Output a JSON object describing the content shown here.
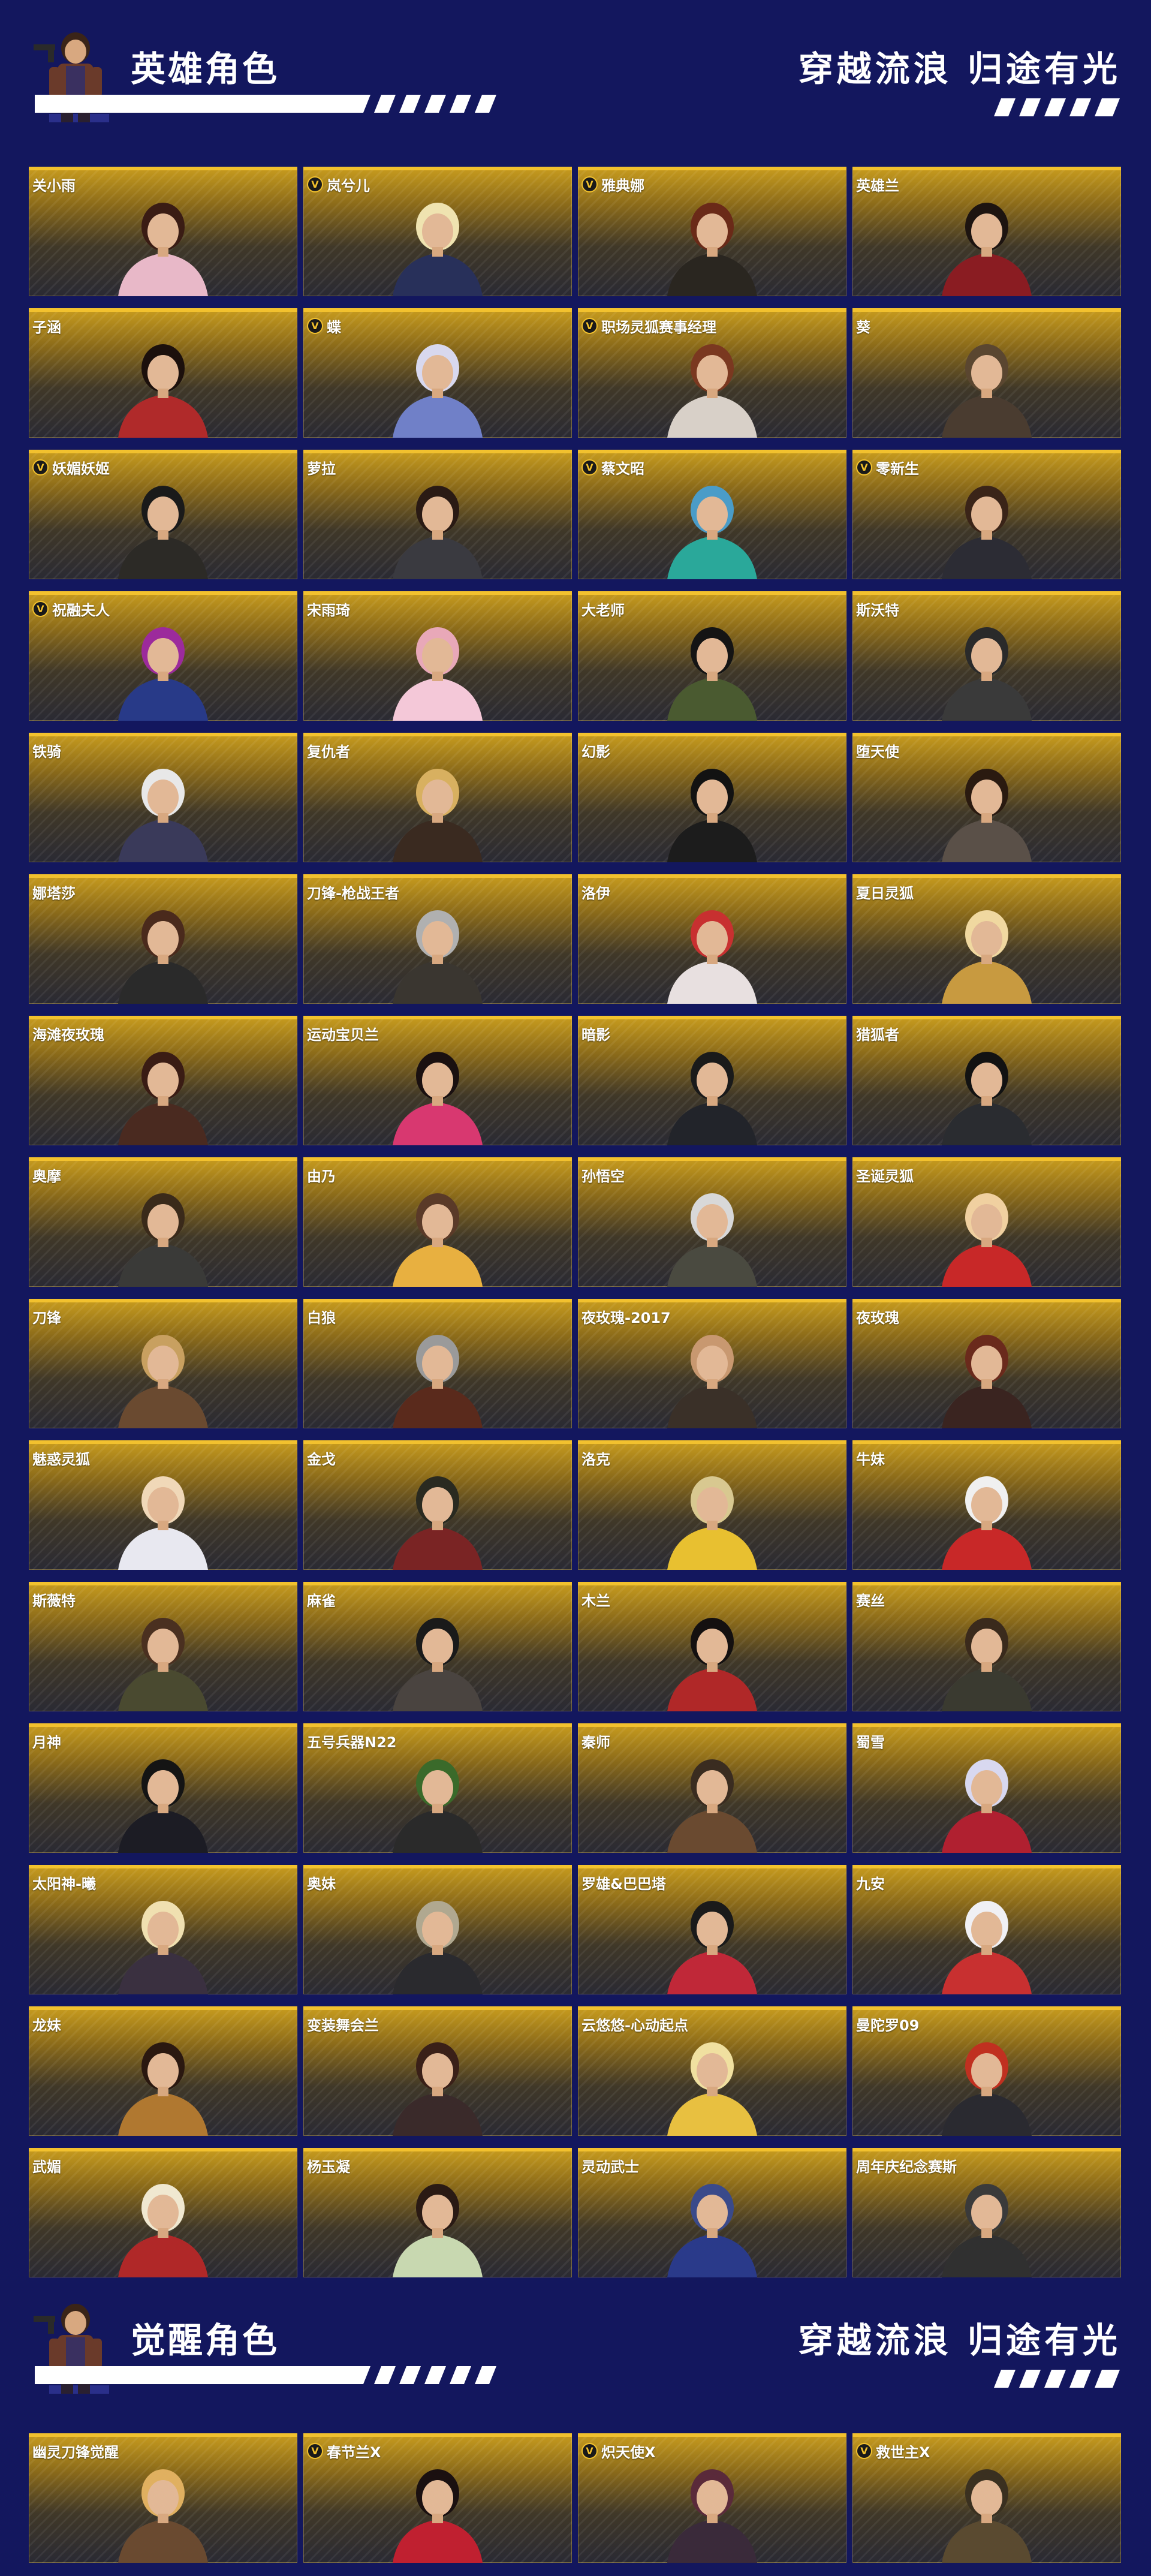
{
  "sections": [
    {
      "title": "英雄角色",
      "slogan": "穿越流浪 归途有光",
      "cards": [
        {
          "name": "关小雨",
          "vip": false,
          "hair": "#3a1c14",
          "outfit": "#e8b8c8"
        },
        {
          "name": "岚兮儿",
          "vip": true,
          "hair": "#efe3b0",
          "outfit": "#28305a"
        },
        {
          "name": "雅典娜",
          "vip": true,
          "hair": "#6a2a18",
          "outfit": "#2a2620"
        },
        {
          "name": "英雄兰",
          "vip": false,
          "hair": "#1d1410",
          "outfit": "#8a1c22"
        },
        {
          "name": "子涵",
          "vip": false,
          "hair": "#1c100c",
          "outfit": "#b02a2a"
        },
        {
          "name": "蝶",
          "vip": true,
          "hair": "#d8d8ee",
          "outfit": "#7080c8"
        },
        {
          "name": "职场灵狐赛事经理",
          "vip": true,
          "hair": "#7a3820",
          "outfit": "#d8d0c8"
        },
        {
          "name": "葵",
          "vip": false,
          "hair": "#5a4630",
          "outfit": "#4a3c30"
        },
        {
          "name": "妖媚妖姬",
          "vip": true,
          "hair": "#1a1a1a",
          "outfit": "#2c2a26"
        },
        {
          "name": "萝拉",
          "vip": false,
          "hair": "#2a1a14",
          "outfit": "#3a3a40"
        },
        {
          "name": "蔡文昭",
          "vip": true,
          "hair": "#4a9cc8",
          "outfit": "#2aa89a"
        },
        {
          "name": "零新生",
          "vip": true,
          "hair": "#3a2418",
          "outfit": "#2c2c34"
        },
        {
          "name": "祝融夫人",
          "vip": true,
          "hair": "#9c2a9c",
          "outfit": "#283a88"
        },
        {
          "name": "宋雨琦",
          "vip": false,
          "hair": "#e8a8b8",
          "outfit": "#f4c8d8"
        },
        {
          "name": "大老师",
          "vip": false,
          "hair": "#141414",
          "outfit": "#4a5a30"
        },
        {
          "name": "斯沃特",
          "vip": false,
          "hair": "#2a2a2a",
          "outfit": "#3a3a3a"
        },
        {
          "name": "铁骑",
          "vip": false,
          "hair": "#e8e8e8",
          "outfit": "#3a3a5a"
        },
        {
          "name": "复仇者",
          "vip": false,
          "hair": "#d8b060",
          "outfit": "#3a2a20"
        },
        {
          "name": "幻影",
          "vip": false,
          "hair": "#121212",
          "outfit": "#1c1c1c"
        },
        {
          "name": "堕天使",
          "vip": false,
          "hair": "#2a1a10",
          "outfit": "#5a5048"
        },
        {
          "name": "娜塔莎",
          "vip": false,
          "hair": "#4a2a1c",
          "outfit": "#2a2a2a"
        },
        {
          "name": "刀锋-枪战王者",
          "vip": false,
          "hair": "#b0b0b0",
          "outfit": "#3a3630"
        },
        {
          "name": "洛伊",
          "vip": false,
          "hair": "#c83030",
          "outfit": "#e8e0e0"
        },
        {
          "name": "夏日灵狐",
          "vip": false,
          "hair": "#f0d8a0",
          "outfit": "#c89a40"
        },
        {
          "name": "海滩夜玫瑰",
          "vip": false,
          "hair": "#3a1c14",
          "outfit": "#4a2a20"
        },
        {
          "name": "运动宝贝兰",
          "vip": false,
          "hair": "#1a1010",
          "outfit": "#d83870"
        },
        {
          "name": "暗影",
          "vip": false,
          "hair": "#1a1a1a",
          "outfit": "#22242a"
        },
        {
          "name": "猎狐者",
          "vip": false,
          "hair": "#121212",
          "outfit": "#2a2c30"
        },
        {
          "name": "奥摩",
          "vip": false,
          "hair": "#3a2a1a",
          "outfit": "#3a3a38"
        },
        {
          "name": "由乃",
          "vip": false,
          "hair": "#5a3a28",
          "outfit": "#e8b040"
        },
        {
          "name": "孙悟空",
          "vip": false,
          "hair": "#d8d8d8",
          "outfit": "#4a4a40"
        },
        {
          "name": "圣诞灵狐",
          "vip": false,
          "hair": "#f0d0a0",
          "outfit": "#c82828"
        },
        {
          "name": "刀锋",
          "vip": false,
          "hair": "#c8a060",
          "outfit": "#6a4a30"
        },
        {
          "name": "白狼",
          "vip": false,
          "hair": "#9a9a9a",
          "outfit": "#5a2a1c"
        },
        {
          "name": "夜玫瑰-2017",
          "vip": false,
          "hair": "#c89870",
          "outfit": "#3a3028"
        },
        {
          "name": "夜玫瑰",
          "vip": false,
          "hair": "#6a2a1c",
          "outfit": "#3a2420"
        },
        {
          "name": "魅惑灵狐",
          "vip": false,
          "hair": "#f0d8b8",
          "outfit": "#e8e8f0"
        },
        {
          "name": "金戈",
          "vip": false,
          "hair": "#2a2a20",
          "outfit": "#7a2424"
        },
        {
          "name": "洛克",
          "vip": false,
          "hair": "#d8c890",
          "outfit": "#e8c030"
        },
        {
          "name": "牛妹",
          "vip": false,
          "hair": "#f0f0f0",
          "outfit": "#c82828"
        },
        {
          "name": "斯薇特",
          "vip": false,
          "hair": "#4a3020",
          "outfit": "#4a4a30"
        },
        {
          "name": "麻雀",
          "vip": false,
          "hair": "#1a1a1a",
          "outfit": "#4a4440"
        },
        {
          "name": "木兰",
          "vip": false,
          "hair": "#141010",
          "outfit": "#b02828"
        },
        {
          "name": "赛丝",
          "vip": false,
          "hair": "#3a2a1c",
          "outfit": "#3a3a30"
        },
        {
          "name": "月神",
          "vip": false,
          "hair": "#141414",
          "outfit": "#1c1c24"
        },
        {
          "name": "五号兵器N22",
          "vip": false,
          "hair": "#3a6a2a",
          "outfit": "#2a2a2a"
        },
        {
          "name": "秦师",
          "vip": false,
          "hair": "#3a2c20",
          "outfit": "#6a4a30"
        },
        {
          "name": "蜀雪",
          "vip": false,
          "hair": "#d8d8f0",
          "outfit": "#b02030"
        },
        {
          "name": "太阳神-曦",
          "vip": false,
          "hair": "#f0e0b0",
          "outfit": "#3a3040"
        },
        {
          "name": "奥妹",
          "vip": false,
          "hair": "#b0a890",
          "outfit": "#2a2a2e"
        },
        {
          "name": "罗雄&巴巴塔",
          "vip": false,
          "hair": "#1a1a1a",
          "outfit": "#c02838"
        },
        {
          "name": "九安",
          "vip": false,
          "hair": "#f0f0f4",
          "outfit": "#c83030"
        },
        {
          "name": "龙妹",
          "vip": false,
          "hair": "#2a1810",
          "outfit": "#b07830"
        },
        {
          "name": "变装舞会兰",
          "vip": false,
          "hair": "#3a2018",
          "outfit": "#3a2a2a"
        },
        {
          "name": "云悠悠-心动起点",
          "vip": false,
          "hair": "#f0e0a0",
          "outfit": "#e8c040"
        },
        {
          "name": "曼陀罗09",
          "vip": false,
          "hair": "#c03020",
          "outfit": "#2a2a30"
        },
        {
          "name": "武媚",
          "vip": false,
          "hair": "#f0e8d0",
          "outfit": "#b02828"
        },
        {
          "name": "杨玉凝",
          "vip": false,
          "hair": "#2a1a14",
          "outfit": "#c8d8b0"
        },
        {
          "name": "灵动武士",
          "vip": false,
          "hair": "#3a4a8a",
          "outfit": "#2a3a8a"
        },
        {
          "name": "周年庆纪念赛斯",
          "vip": false,
          "hair": "#3a3a3a",
          "outfit": "#303030"
        }
      ]
    },
    {
      "title": "觉醒角色",
      "slogan": "穿越流浪 归途有光",
      "cards": [
        {
          "name": "幽灵刀锋觉醒",
          "vip": false,
          "hair": "#e0b060",
          "outfit": "#6a4a30"
        },
        {
          "name": "春节兰X",
          "vip": true,
          "hair": "#1a1010",
          "outfit": "#c02030"
        },
        {
          "name": "炽天使X",
          "vip": true,
          "hair": "#5a2a3a",
          "outfit": "#3a2a3a"
        },
        {
          "name": "救世主X",
          "vip": true,
          "hair": "#3a3020",
          "outfit": "#5a4a30"
        }
      ]
    }
  ],
  "colors": {
    "background": "#13175e",
    "card_accent": "#f2c12e",
    "vip_badge_letter": "V"
  }
}
